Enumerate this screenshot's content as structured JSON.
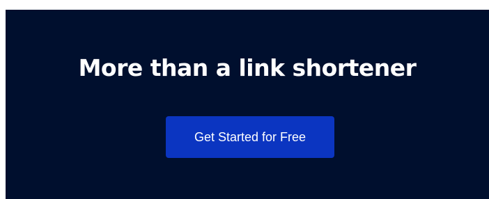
{
  "hero": {
    "headline": "More than a link shortener",
    "cta_label": "Get Started for Free"
  },
  "colors": {
    "background": "#000f2e",
    "cta_background": "#0b35c1",
    "text": "#ffffff"
  }
}
